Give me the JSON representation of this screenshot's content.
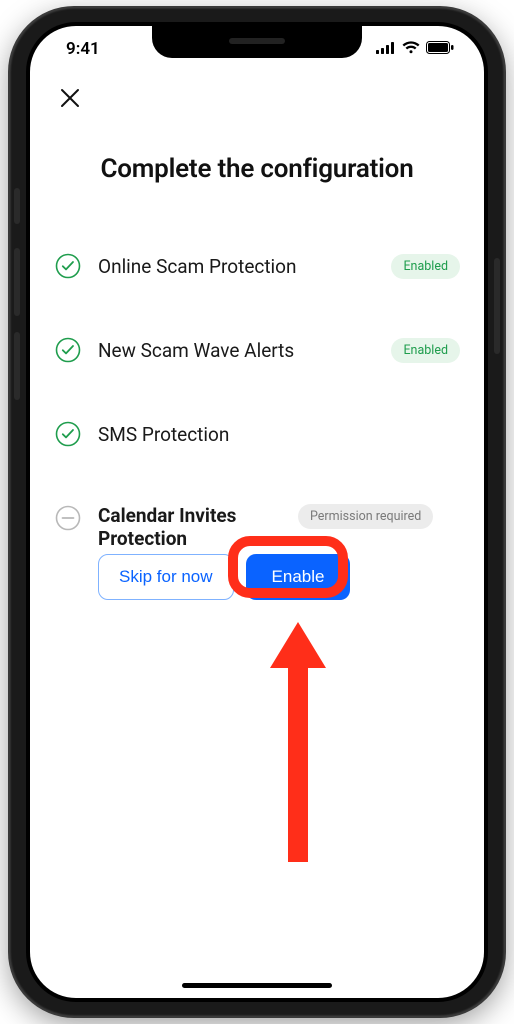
{
  "status": {
    "time": "9:41"
  },
  "page": {
    "title": "Complete the configuration"
  },
  "items": [
    {
      "label": "Online Scam Protection",
      "status": "enabled",
      "badge": "Enabled"
    },
    {
      "label": "New Scam Wave Alerts",
      "status": "enabled",
      "badge": "Enabled"
    },
    {
      "label": "SMS Protection",
      "status": "enabled",
      "badge": ""
    },
    {
      "label": "Calendar Invites Protection",
      "status": "pending",
      "badge": "Permission required"
    }
  ],
  "actions": {
    "skip": "Skip for now",
    "enable": "Enable"
  },
  "colors": {
    "accent": "#0a63ff",
    "success": "#1f9d4d",
    "highlight": "#ff2e19"
  }
}
